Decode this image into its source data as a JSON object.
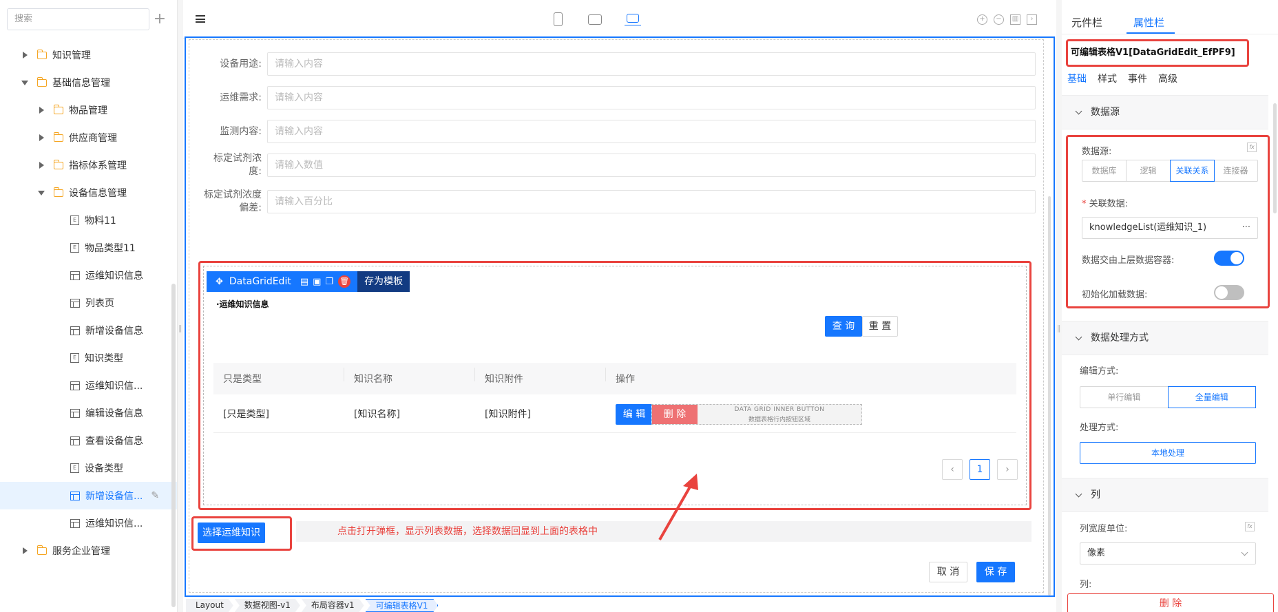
{
  "left": {
    "search_placeholder": "搜索",
    "tree": [
      {
        "label": "知识管理",
        "level": 1,
        "type": "folder",
        "expanded": false
      },
      {
        "label": "基础信息管理",
        "level": 1,
        "type": "folder",
        "expanded": true
      },
      {
        "label": "物品管理",
        "level": 2,
        "type": "folder",
        "expanded": false
      },
      {
        "label": "供应商管理",
        "level": 2,
        "type": "folder",
        "expanded": false
      },
      {
        "label": "指标体系管理",
        "level": 2,
        "type": "folder",
        "expanded": false
      },
      {
        "label": "设备信息管理",
        "level": 2,
        "type": "folder",
        "expanded": true
      },
      {
        "label": "物料11",
        "level": 3,
        "type": "entity"
      },
      {
        "label": "物品类型11",
        "level": 3,
        "type": "entity"
      },
      {
        "label": "运维知识信息",
        "level": 3,
        "type": "page"
      },
      {
        "label": "列表页",
        "level": 3,
        "type": "page"
      },
      {
        "label": "新增设备信息",
        "level": 3,
        "type": "page"
      },
      {
        "label": "知识类型",
        "level": 3,
        "type": "entity"
      },
      {
        "label": "运维知识信...",
        "level": 3,
        "type": "page"
      },
      {
        "label": "编辑设备信息",
        "level": 3,
        "type": "page"
      },
      {
        "label": "查看设备信息",
        "level": 3,
        "type": "page"
      },
      {
        "label": "设备类型",
        "level": 3,
        "type": "entity"
      },
      {
        "label": "新增设备信...",
        "level": 3,
        "type": "page",
        "selected": true
      },
      {
        "label": "运维知识信...",
        "level": 3,
        "type": "page"
      },
      {
        "label": "服务企业管理",
        "level": 1,
        "type": "folder",
        "expanded": false
      }
    ]
  },
  "form": {
    "fields": [
      {
        "label": "设备用途:",
        "placeholder": "请输入内容"
      },
      {
        "label": "运维需求:",
        "placeholder": "请输入内容"
      },
      {
        "label": "监测内容:",
        "placeholder": "请输入内容"
      },
      {
        "label": "标定试剂浓度:",
        "placeholder": "请输入数值"
      },
      {
        "label": "标定试剂浓度偏差:",
        "placeholder": "请输入百分比"
      }
    ]
  },
  "grid": {
    "ctx_name": "DataGridEdit",
    "save_template": "存为模板",
    "title": "·运维知识信息",
    "query": "查 询",
    "reset": "重 置",
    "columns": [
      "只是类型",
      "知识名称",
      "知识附件",
      "操作"
    ],
    "row": [
      "[只是类型]",
      "[知识名称]",
      "[知识附件]"
    ],
    "edit": "编 辑",
    "delete": "删 除",
    "inner_title": "DATA GRID INNER BUTTON",
    "inner_sub": "数据表格行内按钮区域",
    "page": "1"
  },
  "actions": {
    "select_btn": "选择运维知识",
    "tip": "点击打开弹框，显示列表数据，选择数据回显到上面的表格中",
    "cancel": "取 消",
    "save": "保 存"
  },
  "breadcrumbs": [
    "Layout",
    "数据视图-v1",
    "布局容器v1",
    "可编辑表格V1"
  ],
  "right": {
    "tabs": [
      "元件栏",
      "属性栏"
    ],
    "component_title": "可编辑表格V1[DataGridEdit_EfPF9]",
    "subtabs": [
      "基础",
      "样式",
      "事件",
      "高级"
    ],
    "sec_datasource": "数据源",
    "ds_label": "数据源:",
    "ds_options": [
      "数据库",
      "逻辑",
      "关联关系",
      "连接器"
    ],
    "rel_label": "关联数据:",
    "rel_value": "knowledgeList(运维知识_1)",
    "handover_label": "数据交由上层数据容器:",
    "init_label": "初始化加载数据:",
    "sec_processing": "数据处理方式",
    "edit_mode_label": "编辑方式:",
    "edit_modes": [
      "单行编辑",
      "全量编辑"
    ],
    "proc_label": "处理方式:",
    "proc_value": "本地处理",
    "sec_columns": "列",
    "width_unit_label": "列宽度单位:",
    "width_unit_value": "像素",
    "cols_label": "列:",
    "delete": "删 除"
  }
}
